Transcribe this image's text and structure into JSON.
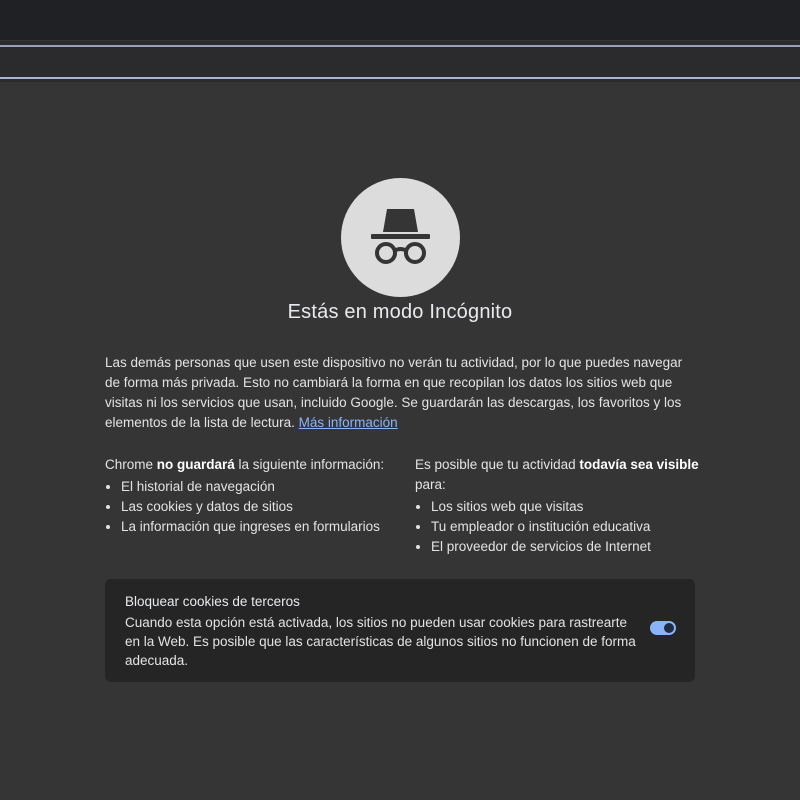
{
  "colors": {
    "page_bg": "#353535",
    "card_bg": "#252526",
    "link": "#8ab4f8",
    "toggle_on": "#8ab4f8"
  },
  "hero": {
    "icon": "incognito-icon",
    "title": "Estás en modo Incógnito"
  },
  "intro": {
    "text": "Las demás personas que usen este dispositivo no verán tu actividad, por lo que puedes navegar de forma más privada. Esto no cambiará la forma en que recopilan los datos los sitios web que visitas ni los servicios que usan, incluido Google. Se guardarán las descargas, los favoritos y los elementos de la lista de lectura.",
    "link_label": "Más información"
  },
  "not_saved": {
    "prefix": "Chrome ",
    "emphasis": "no guardará",
    "suffix": " la siguiente información:",
    "items": [
      "El historial de navegación",
      "Las cookies y datos de sitios",
      "La información que ingreses en formularios"
    ]
  },
  "visible_to": {
    "prefix": "Es posible que tu actividad ",
    "emphasis": "todavía sea visible",
    "suffix": " para:",
    "items": [
      "Los sitios web que visitas",
      "Tu empleador o institución educativa",
      "El proveedor de servicios de Internet"
    ]
  },
  "cookies": {
    "title": "Bloquear cookies de terceros",
    "description": "Cuando esta opción está activada, los sitios no pueden usar cookies para rastrearte en la Web. Es posible que las características de algunos sitios no funcionen de forma adecuada.",
    "toggle_on": true
  }
}
